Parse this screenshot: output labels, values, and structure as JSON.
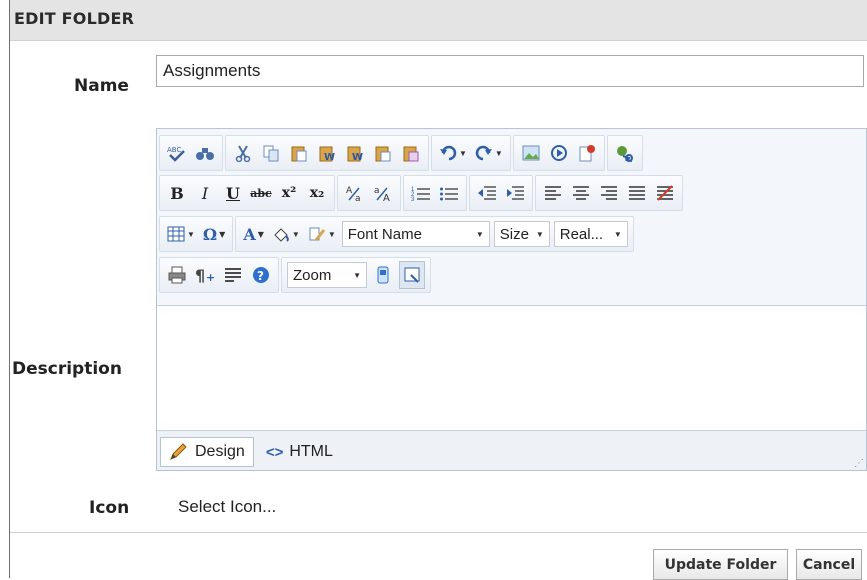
{
  "dialog": {
    "title": "EDIT FOLDER"
  },
  "form": {
    "name_label": "Name",
    "name_value": "Assignments",
    "description_label": "Description",
    "icon_label": "Icon",
    "icon_link": "Select Icon..."
  },
  "editor": {
    "toolbar": {
      "font_name": "Font Name",
      "size": "Size",
      "real": "Real...",
      "zoom": "Zoom",
      "bold": "B",
      "italic": "I",
      "underline": "U",
      "strike": "abc",
      "superscript": "x²",
      "subscript": "x₂",
      "font_color": "A",
      "symbol": "Ω"
    },
    "modes": {
      "design": "Design",
      "html": "HTML"
    }
  },
  "buttons": {
    "update": "Update Folder",
    "cancel": "Cancel"
  },
  "colors": {
    "title_bg": "#e4e4e4",
    "toolbar_bg": "#f3f6fa",
    "editor_border": "#b7c4d6"
  }
}
